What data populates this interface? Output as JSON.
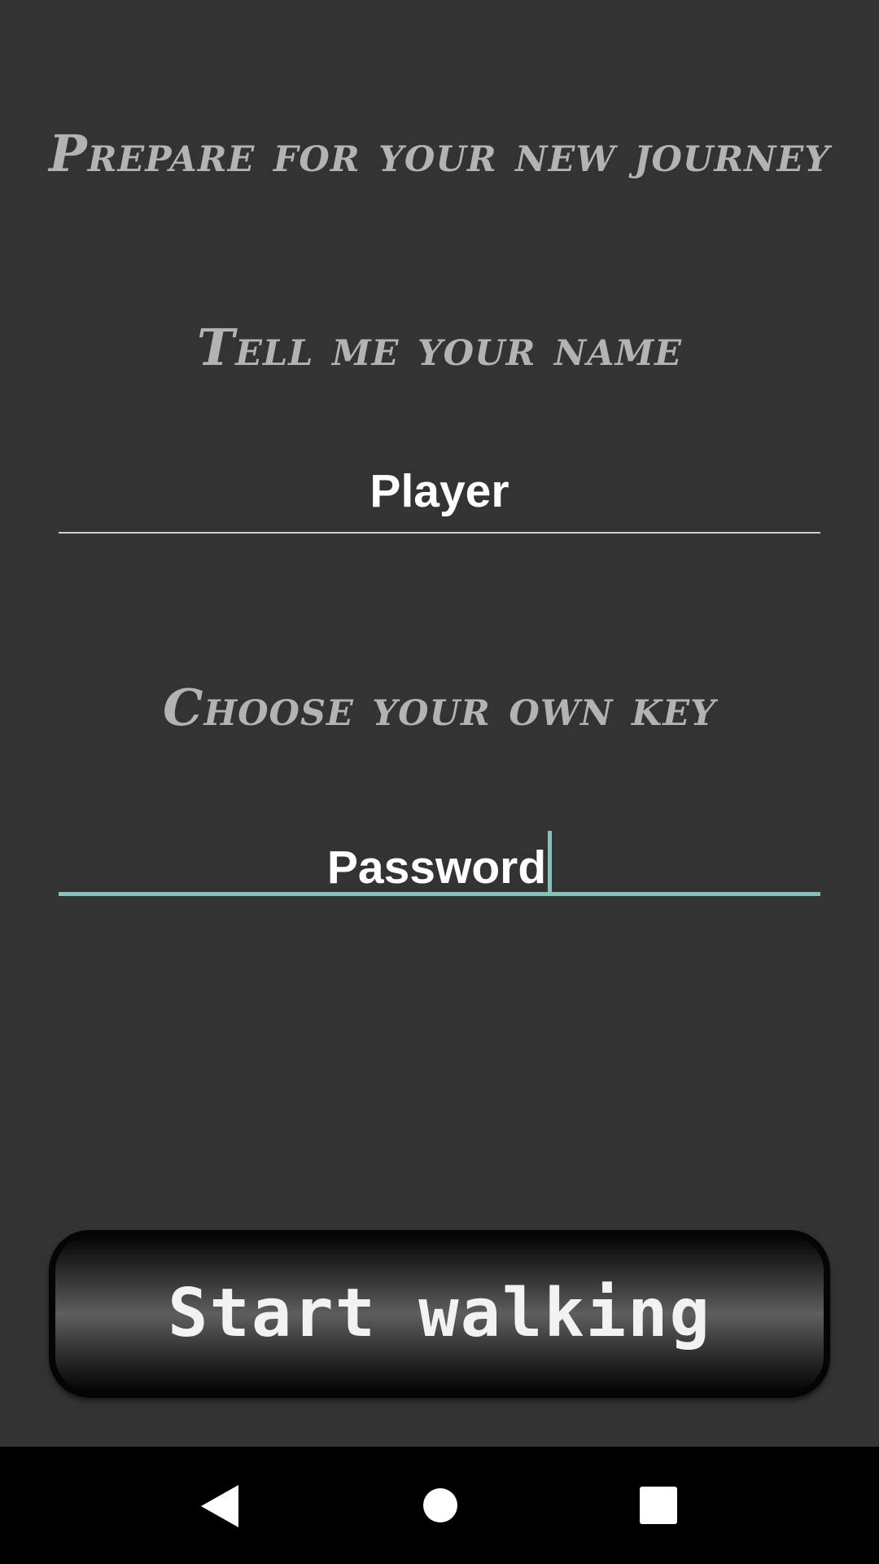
{
  "screen": {
    "heading_journey": "Prepare for your new journey",
    "heading_name": "Tell me your name",
    "heading_key": "Choose your own key"
  },
  "name_field": {
    "value": "Player"
  },
  "key_field": {
    "value": "Password"
  },
  "start_button": {
    "label": "Start walking"
  },
  "nav_bar": {
    "back_icon": "back-triangle-icon",
    "home_icon": "home-circle-icon",
    "recents_icon": "recents-square-icon"
  },
  "colors": {
    "background": "#333333",
    "heading_text": "#b3b3b3",
    "accent": "#7fc4bd",
    "nav_bar": "#000000"
  }
}
